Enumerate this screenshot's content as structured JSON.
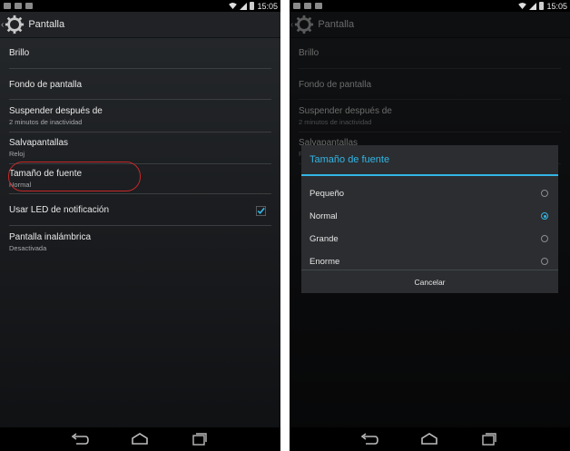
{
  "status_bar": {
    "time": "15:05"
  },
  "action_bar": {
    "title": "Pantalla"
  },
  "settings_items": [
    {
      "title": "Brillo",
      "subtitle": ""
    },
    {
      "title": "Fondo de pantalla",
      "subtitle": ""
    },
    {
      "title": "Suspender después de",
      "subtitle": "2 minutos de inactividad"
    },
    {
      "title": "Salvapantallas",
      "subtitle": "Reloj"
    },
    {
      "title": "Tamaño de fuente",
      "subtitle": "Normal"
    },
    {
      "title": "Usar LED de notificación",
      "subtitle": "",
      "checked": true
    },
    {
      "title": "Pantalla inalámbrica",
      "subtitle": "Desactivada"
    }
  ],
  "dialog": {
    "title": "Tamaño de fuente",
    "options": [
      "Pequeño",
      "Normal",
      "Grande",
      "Enorme"
    ],
    "selected": "Normal",
    "cancel_label": "Cancelar"
  },
  "colors": {
    "accent": "#33b5e5",
    "highlight_circle": "#c62828"
  },
  "icons": [
    "gear-icon",
    "wifi-icon",
    "signal-icon",
    "battery-icon",
    "back-icon",
    "home-icon",
    "recents-icon",
    "check-icon"
  ]
}
